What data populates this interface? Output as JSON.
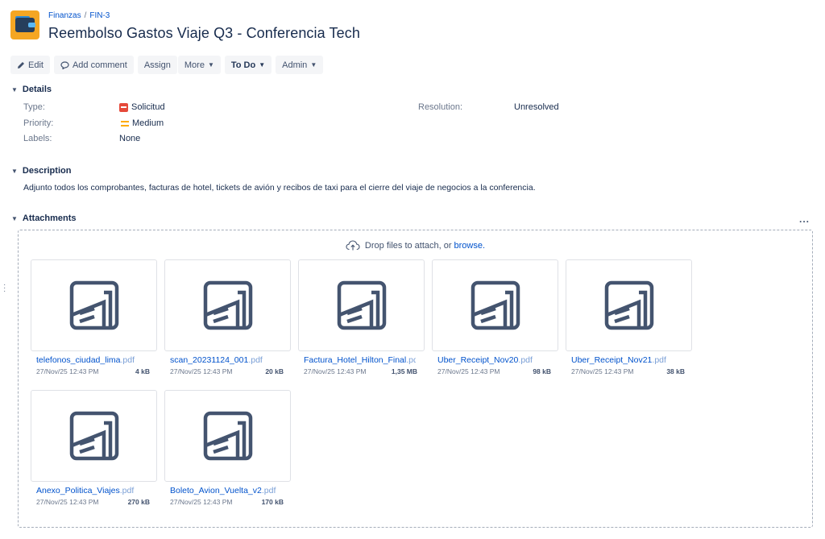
{
  "breadcrumb": {
    "project": "Finanzas",
    "separator": "/",
    "issue_key": "FIN-3"
  },
  "title": "Reembolso Gastos Viaje Q3 - Conferencia Tech",
  "toolbar": {
    "edit": "Edit",
    "add_comment": "Add comment",
    "assign": "Assign",
    "more": "More",
    "status": "To Do",
    "admin": "Admin"
  },
  "details": {
    "heading": "Details",
    "type_label": "Type:",
    "type_value": "Solicitud",
    "priority_label": "Priority:",
    "priority_value": "Medium",
    "labels_label": "Labels:",
    "labels_value": "None",
    "resolution_label": "Resolution:",
    "resolution_value": "Unresolved"
  },
  "description": {
    "heading": "Description",
    "text": "Adjunto todos los comprobantes, facturas de hotel, tickets de avión y recibos de taxi para el cierre del viaje de negocios a la conferencia."
  },
  "attachments": {
    "heading": "Attachments",
    "more": "...",
    "drop_text": "Drop files to attach, or",
    "browse": "browse.",
    "items": [
      {
        "name": "telefonos_ciudad_lima",
        "ext": ".pdf",
        "date": "27/Nov/25 12:43 PM",
        "size": "4 kB"
      },
      {
        "name": "scan_20231124_001",
        "ext": ".pdf",
        "date": "27/Nov/25 12:43 PM",
        "size": "20 kB"
      },
      {
        "name": "Factura_Hotel_Hilton_Final",
        "ext": ".pdf",
        "date": "27/Nov/25 12:43 PM",
        "size": "1,35 MB"
      },
      {
        "name": "Uber_Receipt_Nov20",
        "ext": ".pdf",
        "date": "27/Nov/25 12:43 PM",
        "size": "98 kB"
      },
      {
        "name": "Uber_Receipt_Nov21",
        "ext": ".pdf",
        "date": "27/Nov/25 12:43 PM",
        "size": "38 kB"
      },
      {
        "name": "Anexo_Politica_Viajes",
        "ext": ".pdf",
        "date": "27/Nov/25 12:43 PM",
        "size": "270 kB"
      },
      {
        "name": "Boleto_Avion_Vuelta_v2",
        "ext": ".pdf",
        "date": "27/Nov/25 12:43 PM",
        "size": "170 kB"
      }
    ]
  }
}
